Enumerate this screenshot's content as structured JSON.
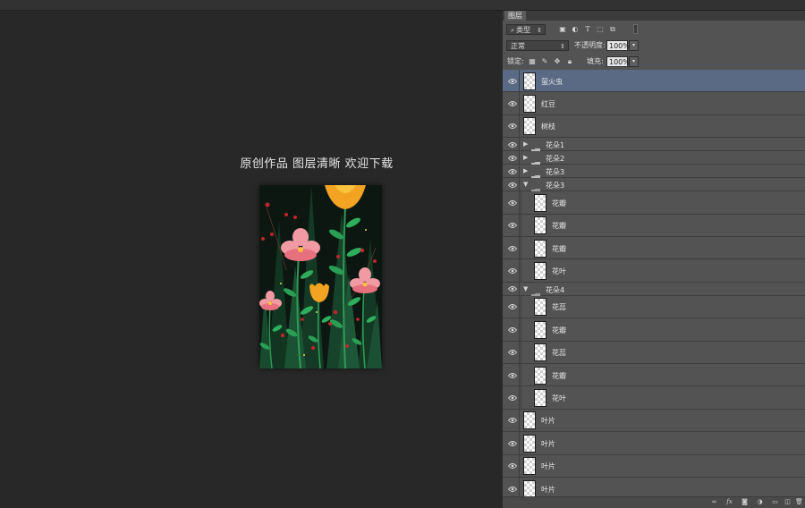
{
  "canvas": {
    "caption": "原创作品 图层清晰 欢迎下载"
  },
  "panel": {
    "tab_label": "图层",
    "filter_dropdown": "类型",
    "blend_mode": "正常",
    "opacity_label": "不透明度:",
    "opacity_value": "100%",
    "lock_label": "锁定:",
    "fill_label": "填充:",
    "fill_value": "100%",
    "filter_icons": [
      "image-filter-icon",
      "adjustment-filter-icon",
      "text-filter-icon",
      "shape-filter-icon",
      "smart-object-filter-icon",
      "filter-toggle-icon"
    ],
    "lock_icons": [
      "lock-transparent-icon",
      "lock-image-icon",
      "lock-position-icon",
      "lock-all-icon"
    ],
    "bottom_icons": [
      "link-layers-icon",
      "fx-icon",
      "add-mask-icon",
      "adjustment-layer-icon",
      "new-group-icon",
      "new-layer-icon",
      "delete-layer-icon"
    ]
  },
  "layers": [
    {
      "name": "萤火虫",
      "kind": "layer",
      "selected": true
    },
    {
      "name": "红豆",
      "kind": "layer"
    },
    {
      "name": "树枝",
      "kind": "layer"
    },
    {
      "name": "花朵1",
      "kind": "group",
      "expanded": false
    },
    {
      "name": "花朵2",
      "kind": "group",
      "expanded": false
    },
    {
      "name": "花朵3",
      "kind": "group",
      "expanded": false
    },
    {
      "name": "花朵3",
      "kind": "group",
      "expanded": true
    },
    {
      "name": "花瓣",
      "kind": "layer",
      "indent": true
    },
    {
      "name": "花瓣",
      "kind": "layer",
      "indent": true
    },
    {
      "name": "花瓣",
      "kind": "layer",
      "indent": true
    },
    {
      "name": "花叶",
      "kind": "layer",
      "indent": true
    },
    {
      "name": "花朵4",
      "kind": "group",
      "expanded": true
    },
    {
      "name": "花蕊",
      "kind": "layer",
      "indent": true
    },
    {
      "name": "花瓣",
      "kind": "layer",
      "indent": true
    },
    {
      "name": "花蕊",
      "kind": "layer",
      "indent": true
    },
    {
      "name": "花瓣",
      "kind": "layer",
      "indent": true
    },
    {
      "name": "花叶",
      "kind": "layer",
      "indent": true
    },
    {
      "name": "叶片",
      "kind": "layer"
    },
    {
      "name": "叶片",
      "kind": "layer"
    },
    {
      "name": "叶片",
      "kind": "layer"
    },
    {
      "name": "叶片",
      "kind": "layer"
    }
  ],
  "colors": {
    "selected_row": "#5a6a85",
    "panel_bg": "#535353",
    "workspace_bg": "#282828"
  }
}
